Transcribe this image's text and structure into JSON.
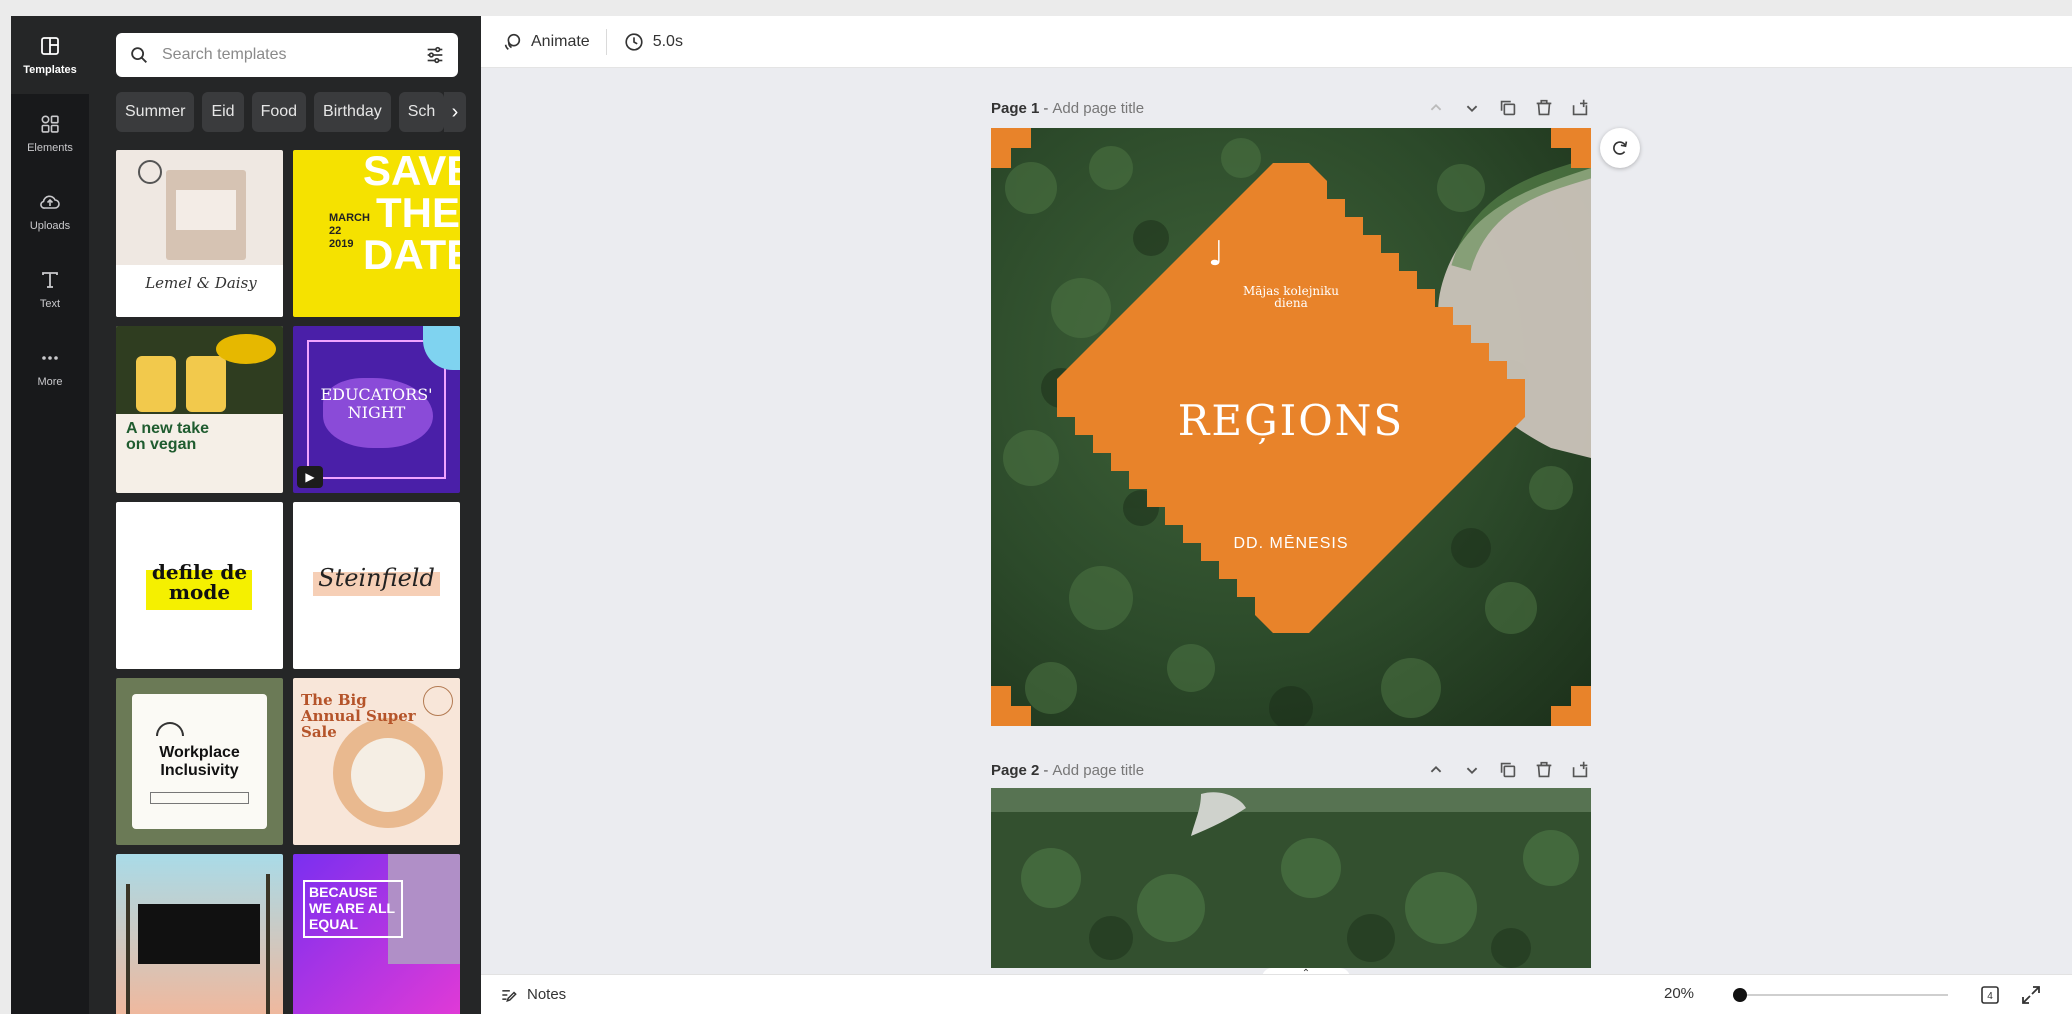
{
  "rail": {
    "items": [
      {
        "label": "Templates",
        "icon": "templates-icon",
        "active": true
      },
      {
        "label": "Elements",
        "icon": "elements-icon",
        "active": false
      },
      {
        "label": "Uploads",
        "icon": "uploads-icon",
        "active": false
      },
      {
        "label": "Text",
        "icon": "text-icon",
        "active": false
      },
      {
        "label": "More",
        "icon": "more-icon",
        "active": false
      }
    ]
  },
  "panel": {
    "search_placeholder": "Search templates",
    "chips": [
      "Summer",
      "Eid",
      "Food",
      "Birthday",
      "Sch"
    ],
    "templates": [
      {
        "title": "Lemel & Daisy",
        "theme": "soap"
      },
      {
        "title": "SAVE THE DATE",
        "sub": "MARCH 22 2019",
        "theme": "yellow"
      },
      {
        "title": "A new take on vegan",
        "theme": "vegan"
      },
      {
        "title": "EDUCATORS' NIGHT",
        "theme": "purple"
      },
      {
        "title": "defile de mode",
        "theme": "defile"
      },
      {
        "title": "Steinfield",
        "theme": "steinfield"
      },
      {
        "title": "Workplace Inclusivity",
        "theme": "workplace"
      },
      {
        "title": "The Big Annual Super Sale",
        "theme": "sale"
      },
      {
        "title": "",
        "theme": "palms"
      },
      {
        "title": "BECAUSE WE ARE ALL EQUAL",
        "theme": "equal"
      }
    ]
  },
  "toolbar": {
    "animate_label": "Animate",
    "duration_label": "5.0s"
  },
  "pages": [
    {
      "label": "Page 1",
      "title_placeholder": "Add page title"
    },
    {
      "label": "Page 2",
      "title_placeholder": "Add page title"
    }
  ],
  "design": {
    "small_text": "Mājas kolejniku diena",
    "title": "REĢIONS",
    "subtitle": "DD. MĒNESIS",
    "accent": "#e8832a"
  },
  "bottombar": {
    "notes_label": "Notes",
    "zoom_label": "20%",
    "zoom_fraction": 0.0
  }
}
